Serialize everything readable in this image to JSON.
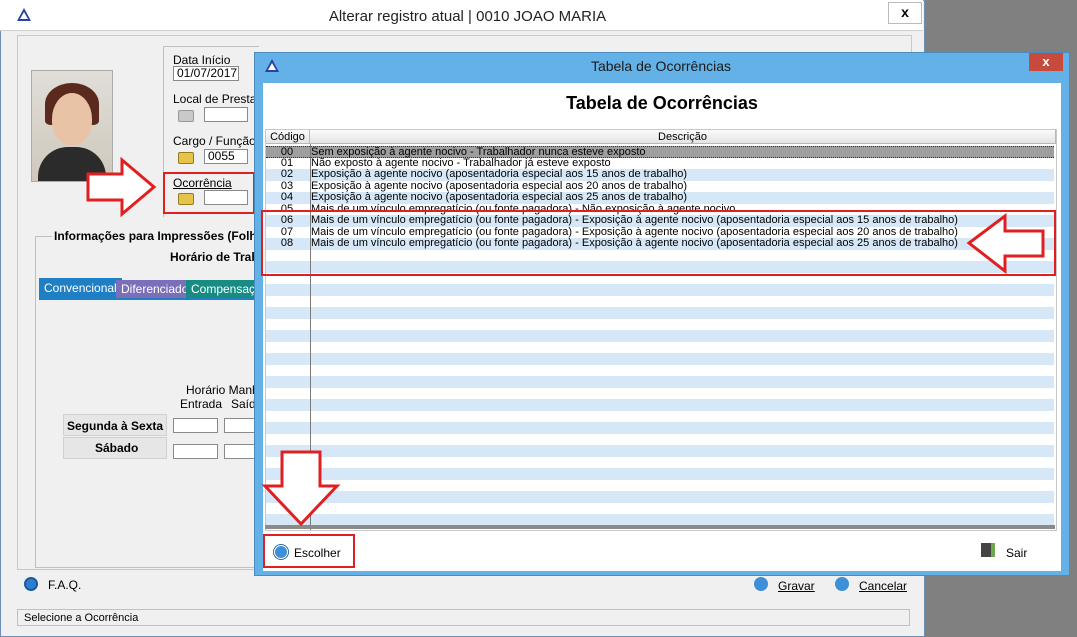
{
  "background_window": {
    "title": "Alterar registro atual | 0010 JOAO MARIA",
    "close": "x",
    "data_inicio_label": "Data Início",
    "data_inicio_value": "01/07/2017",
    "local_label": "Local de Prestaç",
    "cargo_label": "Cargo / Função",
    "cargo_value": "0055",
    "ocorrencia_label": "Ocorrência",
    "info_group_label": "Informações para Impressões (Folha",
    "horario_trab_label": "Horário de Trab",
    "tabs": [
      "Convencional",
      "Diferenciado",
      "Compensação"
    ],
    "horario_manha_label": "Horário Manhã",
    "entrada_label": "Entrada",
    "saida_label": "Saíd",
    "rows": [
      "Segunda à Sexta",
      "Sábado"
    ],
    "faq_label": "F.A.Q.",
    "gravar_label": "Gravar",
    "cancelar_label": "Cancelar",
    "status_text": "Selecione a Ocorrência"
  },
  "modal": {
    "title": "Tabela de Ocorrências",
    "close": "x",
    "heading": "Tabela de Ocorrências",
    "columns": {
      "codigo": "Código",
      "descricao": "Descrição"
    },
    "rows": [
      {
        "code": "00",
        "desc": "Sem exposição à agente nocivo - Trabalhador nunca esteve exposto"
      },
      {
        "code": "01",
        "desc": "Não exposto à agente nocivo - Trabalhador já esteve exposto"
      },
      {
        "code": "02",
        "desc": "Exposição à agente nocivo (aposentadoria especial aos 15 anos de trabalho)"
      },
      {
        "code": "03",
        "desc": "Exposição à agente nocivo (aposentadoria especial aos 20 anos de trabalho)"
      },
      {
        "code": "04",
        "desc": "Exposição à agente nocivo (aposentadoria especial aos 25 anos de trabalho)"
      },
      {
        "code": "05",
        "desc": "Mais de um vínculo empregatício (ou fonte pagadora) - Não exposição à agente nocivo"
      },
      {
        "code": "06",
        "desc": "Mais de um vínculo empregatício (ou fonte pagadora) - Exposição à agente nocivo (aposentadoria especial aos 15 anos de trabalho)"
      },
      {
        "code": "07",
        "desc": "Mais de um vínculo empregatício (ou fonte pagadora) - Exposição à agente nocivo (aposentadoria especial aos 20 anos de trabalho)"
      },
      {
        "code": "08",
        "desc": "Mais de um vínculo empregatício (ou fonte pagadora) - Exposição à agente nocivo (aposentadoria especial aos 25 anos de trabalho)"
      }
    ],
    "selected_code": "00",
    "escolher_label": "Escolher",
    "sair_label": "Sair"
  },
  "colors": {
    "modal_frame": "#63b1e6",
    "stripe": "#d6e8f7",
    "selected_row": "#9e9e9e",
    "annotation_red": "#e02020",
    "tab_convencional": "#1f7fc4",
    "tab_diferenciado": "#7a6fb8",
    "tab_compensacao": "#178c82"
  }
}
